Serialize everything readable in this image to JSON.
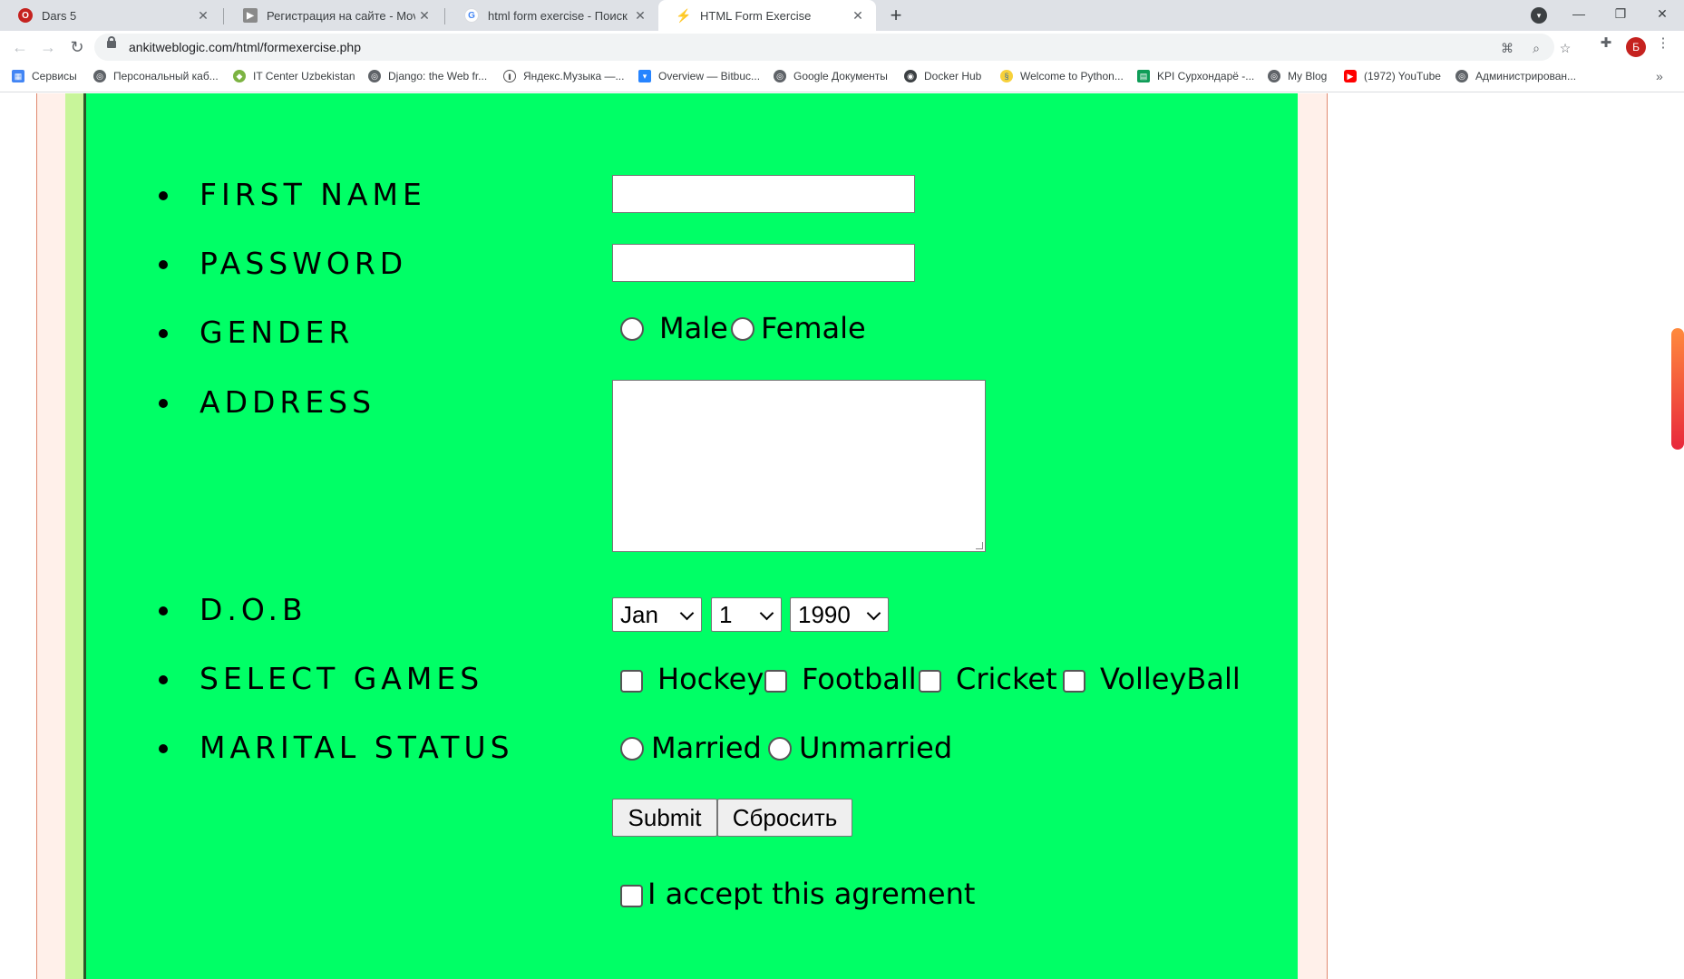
{
  "browser": {
    "tabs": [
      {
        "title": "Dars 5",
        "active": false
      },
      {
        "title": "Регистрация на сайте - Mover.uz",
        "active": false
      },
      {
        "title": "html form exercise - Поиск в Google",
        "active": false
      },
      {
        "title": "HTML Form Exercise",
        "active": true
      }
    ],
    "url": "ankitweblogic.com/html/formexercise.php",
    "profile_initial": "Б",
    "bookmarks": [
      {
        "label": "Сервисы",
        "icon": "apps-icon"
      },
      {
        "label": "Персональный каб...",
        "icon": "globe-icon"
      },
      {
        "label": "IT Center Uzbekistan",
        "icon": "cube-icon"
      },
      {
        "label": "Django: the Web fr...",
        "icon": "globe-icon"
      },
      {
        "label": "Яндекс.Музыка —...",
        "icon": "pause-icon"
      },
      {
        "label": "Overview — Bitbuc...",
        "icon": "bitbucket-icon"
      },
      {
        "label": "Google Документы",
        "icon": "globe-icon"
      },
      {
        "label": "Docker Hub",
        "icon": "docker-icon"
      },
      {
        "label": "Welcome to Python...",
        "icon": "python-icon"
      },
      {
        "label": "KPI Сурхондарё -...",
        "icon": "sheet-icon"
      },
      {
        "label": "My Blog",
        "icon": "globe-icon"
      },
      {
        "label": "(1972) YouTube",
        "icon": "youtube-icon"
      },
      {
        "label": "Администрирован...",
        "icon": "globe-icon"
      }
    ]
  },
  "form": {
    "labels": {
      "first_name": "FIRST NAME",
      "password": "PASSWORD",
      "gender": "GENDER",
      "address": "ADDRESS",
      "dob": "D.O.B",
      "games": "SELECT GAMES",
      "marital": "MARITAL STATUS"
    },
    "gender_options": [
      "Male",
      "Female"
    ],
    "dob": {
      "month": "Jan",
      "day": "1",
      "year": "1990"
    },
    "games": [
      "Hockey",
      "Football",
      "Cricket",
      "VolleyBall"
    ],
    "marital_options": [
      "Married",
      "Unmarried"
    ],
    "submit_label": "Submit",
    "reset_label": "Сбросить",
    "agreement_label": "I accept this agrement"
  },
  "colors": {
    "panel": "#00ff66",
    "side_stripe": "#c8f59a",
    "outer_bg": "#fff0ea"
  }
}
